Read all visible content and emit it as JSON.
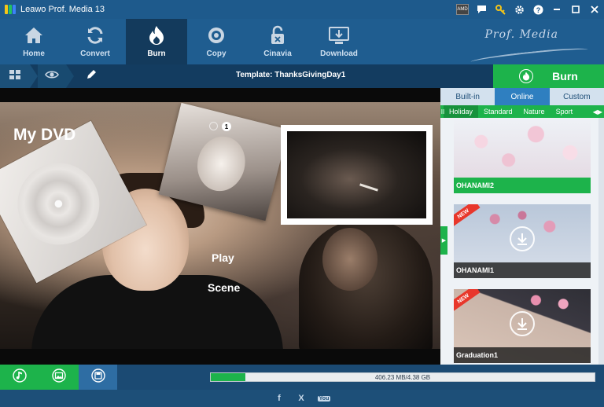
{
  "window": {
    "title": "Leawo Prof. Media 13",
    "amd_badge": "AMD",
    "icons": [
      "amd-badge-icon",
      "chat-icon",
      "key-icon",
      "gear-icon",
      "help-icon",
      "minimize-icon",
      "maximize-icon",
      "close-icon"
    ]
  },
  "toolbar": {
    "items": [
      {
        "label": "Home",
        "icon": "home-icon"
      },
      {
        "label": "Convert",
        "icon": "convert-icon"
      },
      {
        "label": "Burn",
        "icon": "flame-icon",
        "active": true
      },
      {
        "label": "Copy",
        "icon": "disc-icon"
      },
      {
        "label": "Cinavia",
        "icon": "unlock-icon"
      },
      {
        "label": "Download",
        "icon": "download-icon"
      }
    ],
    "brand": "Prof. Media"
  },
  "subbar": {
    "template_label": "Template: ThanksGivingDay1",
    "burn_label": "Burn",
    "icons": [
      "grid-view-icon",
      "preview-eye-icon",
      "edit-pencil-icon",
      "flame-icon"
    ]
  },
  "preview": {
    "title": "My DVD",
    "menu_items": [
      "Play",
      "Scene"
    ],
    "page_number": "1"
  },
  "panel": {
    "tabs": [
      {
        "label": "Built-in",
        "selected": false
      },
      {
        "label": "Online",
        "selected": true
      },
      {
        "label": "Custom",
        "selected": false
      }
    ],
    "categories": [
      {
        "label": "Holiday",
        "selected": true
      },
      {
        "label": "Standard",
        "selected": false
      },
      {
        "label": "Nature",
        "selected": false
      },
      {
        "label": "Sport",
        "selected": false
      }
    ],
    "templates": [
      {
        "name": "OHANAMI2",
        "new": false,
        "downloaded": true
      },
      {
        "name": "OHANAMI1",
        "new": true,
        "downloaded": false
      },
      {
        "name": "Graduation1",
        "new": true,
        "downloaded": false
      }
    ],
    "new_label": "NEW"
  },
  "bottom": {
    "buttons": [
      "music-note-icon",
      "image-icon",
      "disc-save-icon"
    ],
    "capacity_text": "406.23 MB/4.38 GB",
    "capacity_fraction": 0.09
  },
  "footer": {
    "social": [
      {
        "label": "f",
        "icon": "facebook-icon"
      },
      {
        "label": "X",
        "icon": "x-twitter-icon"
      },
      {
        "label": "You",
        "icon": "youtube-icon"
      }
    ]
  },
  "colors": {
    "accent_green": "#1db34b",
    "toolbar_blue": "#1f5d90",
    "dark_blue": "#133c60",
    "tab_selected": "#2f7fc0"
  }
}
